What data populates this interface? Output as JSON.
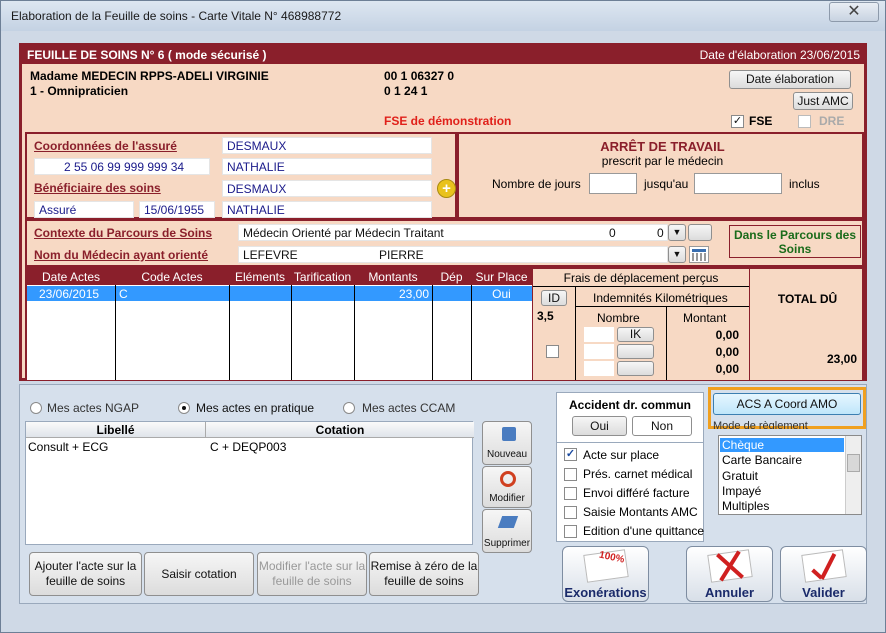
{
  "window": {
    "title": "Elaboration de la Feuille de soins - Carte Vitale N° 468988772",
    "close": "✕"
  },
  "header": {
    "title": "FEUILLE DE SOINS  N° 6 ( mode sécurisé )",
    "date_elaboration": "Date d'élaboration 23/06/2015",
    "praticien_name": "Madame MEDECIN RPPS-ADELI VIRGINIE",
    "praticien_code1": "00 1 06327 0",
    "praticien_specialite": "1 - Omnipraticien",
    "praticien_code2": "0 1 24 1",
    "demo": "FSE de démonstration",
    "btn_date": "Date élaboration",
    "btn_amc": "Just AMC",
    "fse_label": "FSE",
    "fse_check": "✓",
    "dre_label": "DRE"
  },
  "assure": {
    "coord_label": "Coordonnées de l'assuré",
    "nom": "DESMAUX",
    "nir": "2 55 06 99 999 999 34",
    "prenom": "NATHALIE",
    "benef_label": "Bénéficiaire des soins",
    "benef_nom": "DESMAUX",
    "qualite": "Assuré",
    "naissance": "15/06/1955",
    "benef_prenom": "NATHALIE",
    "plus": "+"
  },
  "arret": {
    "title": "ARRÊT DE TRAVAIL",
    "subtitle": "prescrit par le médecin",
    "jours": "Nombre de jours",
    "jusqu": "jusqu'au",
    "inclus": "inclus"
  },
  "parcours": {
    "contexte_label": "Contexte du Parcours de Soins",
    "contexte_value": "Médecin Orienté par Médecin Traitant",
    "contexte_n1": "0",
    "contexte_n2": "0",
    "medecin_label": "Nom du Médecin ayant orienté",
    "medecin_nom": "LEFEVRE",
    "medecin_prenom": "PIERRE",
    "badge": "Dans le Parcours des Soins",
    "arrow": "▼"
  },
  "actes_table": {
    "headers": [
      "Date Actes",
      "Code Actes",
      "Eléments",
      "Tarification",
      "Montants",
      "Dép",
      "Sur Place"
    ],
    "row": {
      "date": "23/06/2015",
      "code": "C",
      "montant": "23,00",
      "surplace": "Oui"
    },
    "frais_title": "Frais de déplacement perçus",
    "id_btn": "ID",
    "ik_title": "Indemnités Kilométriques",
    "val": "3,5",
    "nombre": "Nombre",
    "montant": "Montant",
    "ik_btn": "IK",
    "z1": "0,00",
    "z2": "0,00",
    "z3": "0,00",
    "total_title": "TOTAL DÛ",
    "total": "23,00"
  },
  "lower": {
    "radio_ngap": "Mes actes NGAP",
    "radio_pratique": "Mes actes en pratique",
    "radio_ccam": "Mes actes CCAM",
    "col_libelle": "Libellé",
    "col_cotation": "Cotation",
    "row_libelle": "Consult + ECG",
    "row_cotation": "C + DEQP003",
    "nouveau": "Nouveau",
    "modifier": "Modifier",
    "supprimer": "Supprimer",
    "btn_ajouter": "Ajouter l'acte sur la feuille de soins",
    "btn_saisir": "Saisir cotation",
    "btn_modifier": "Modifier l'acte sur la feuille de soins",
    "btn_remise": "Remise à zéro de la feuille de soins"
  },
  "accident": {
    "title": "Accident dr. commun",
    "oui": "Oui",
    "non": "Non",
    "acte_sur_place": "Acte sur place",
    "pres_carnet": "Prés. carnet médical",
    "envoi_differe": "Envoi différé facture",
    "saisie_amc": "Saisie Montants AMC",
    "edition": "Edition d'une quittance",
    "check": "✓"
  },
  "reglement": {
    "acs_btn": "ACS A Coord AMO",
    "mode_label": "Mode de règlement",
    "options": [
      "Chèque",
      "Carte Bancaire",
      "Gratuit",
      "Impayé",
      "Multiples"
    ]
  },
  "actions": {
    "exonerations": "Exonérations",
    "annuler": "Annuler",
    "valider": "Valider",
    "badge100": "100%"
  },
  "colors": {
    "dark_red": "#8a1f2b",
    "salmon": "#f7d9c4",
    "selection": "#3399ff",
    "highlight": "#f0a020"
  }
}
